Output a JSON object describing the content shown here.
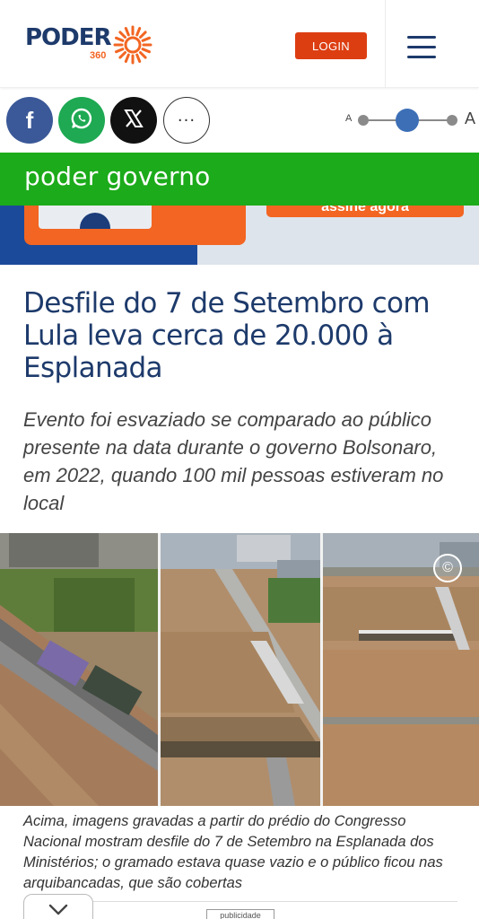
{
  "header": {
    "logo_word": "PODER",
    "logo_number": "360",
    "login_label": "LOGIN"
  },
  "share": {
    "facebook_glyph": "f",
    "more_glyph": "···"
  },
  "font_size": {
    "small_label": "A",
    "large_label": "A",
    "level": 0.5
  },
  "section": {
    "label": "poder governo"
  },
  "ad": {
    "cta_text": "assine agora"
  },
  "article": {
    "headline": "Desfile do 7 de Setembro com Lula leva cerca de 20.000 à Esplanada",
    "subheadline": "Evento foi esvaziado se comparado ao público presente na data durante o governo Bolsonaro, em 2022, quando 100 mil pessoas estiveram no local",
    "photo_credit_symbol": "©",
    "caption": "Acima, imagens gravadas a partir do prédio do Congresso Nacional mostram desfile do 7 de Setembro na Esplanada dos Ministérios; o gramado estava quase vazio e o público ficou nas arquibancadas, que são cobertas"
  },
  "footer": {
    "ad_label": "publicidade"
  },
  "colors": {
    "brand_blue": "#1d3a6b",
    "brand_orange": "#f26522",
    "login_red": "#dc3e12",
    "section_green": "#1cab1a",
    "facebook": "#3b5998",
    "whatsapp": "#1ea952",
    "x": "#111111"
  }
}
